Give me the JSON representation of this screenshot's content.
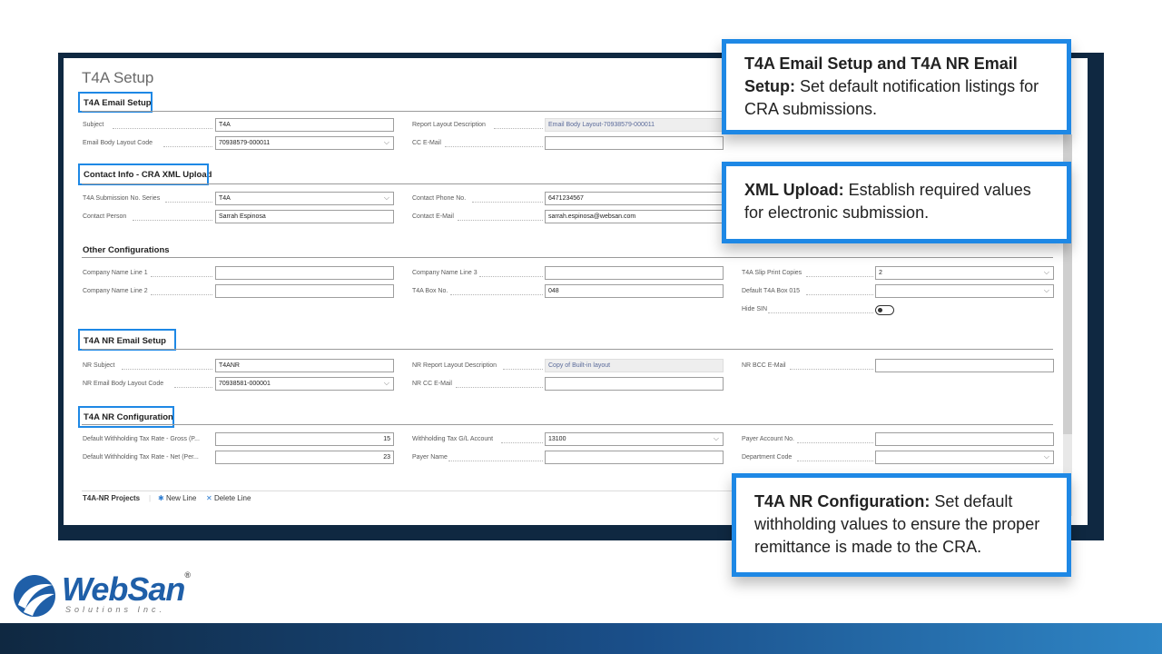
{
  "page_title": "T4A Setup",
  "sections": {
    "email_setup": "T4A Email Setup",
    "contact_info": "Contact Info - CRA XML Upload",
    "other_config": "Other Configurations",
    "nr_email_setup": "T4A NR Email Setup",
    "nr_config": "T4A NR Configuration"
  },
  "email_setup": {
    "subject": {
      "label": "Subject",
      "value": "T4A"
    },
    "body_layout": {
      "label": "Email Body Layout Code",
      "value": "70938579-000011"
    },
    "report_layout": {
      "label": "Report Layout Description",
      "value": "Email Body Layout-70938579-000011"
    },
    "cc_email": {
      "label": "CC E-Mail",
      "value": ""
    }
  },
  "contact_info": {
    "submission_series": {
      "label": "T4A Submission No. Series",
      "value": "T4A"
    },
    "contact_person": {
      "label": "Contact Person",
      "value": "Sarrah Espinosa"
    },
    "phone": {
      "label": "Contact Phone No.",
      "value": "6471234567"
    },
    "email": {
      "label": "Contact E-Mail",
      "value": "sarrah.espinosa@websan.com"
    }
  },
  "other_config": {
    "company_line1": {
      "label": "Company Name Line 1",
      "value": ""
    },
    "company_line2": {
      "label": "Company Name Line 2",
      "value": ""
    },
    "company_line3": {
      "label": "Company Name Line 3",
      "value": ""
    },
    "box_no": {
      "label": "T4A Box No.",
      "value": "048"
    },
    "slip_copies": {
      "label": "T4A Slip Print Copies",
      "value": "2"
    },
    "default_box": {
      "label": "Default T4A Box 015",
      "value": ""
    },
    "hide_sin": {
      "label": "Hide SIN",
      "on": false
    }
  },
  "nr_email_setup": {
    "subject": {
      "label": "NR Subject",
      "value": "T4ANR"
    },
    "body_layout": {
      "label": "NR Email Body Layout Code",
      "value": "70938581-000001"
    },
    "report_layout": {
      "label": "NR Report Layout Description",
      "value": "Copy of Built-in layout"
    },
    "cc_email": {
      "label": "NR CC E-Mail",
      "value": ""
    },
    "bcc_email": {
      "label": "NR BCC E-Mail",
      "value": ""
    }
  },
  "nr_config": {
    "rate_gross": {
      "label": "Default Withholding Tax Rate - Gross (P...",
      "value": "15"
    },
    "rate_net": {
      "label": "Default Withholding Tax Rate - Net (Per...",
      "value": "23"
    },
    "gl_account": {
      "label": "Withholding Tax G/L Account",
      "value": "13100"
    },
    "payer_name": {
      "label": "Payer Name",
      "value": ""
    },
    "payer_account": {
      "label": "Payer Account No.",
      "value": ""
    },
    "department": {
      "label": "Department Code",
      "value": ""
    }
  },
  "projects": {
    "title": "T4A-NR Projects",
    "new_line": "New Line",
    "delete_line": "Delete Line"
  },
  "callouts": {
    "email": {
      "bold": "T4A Email Setup and T4A NR Email Setup:",
      "text": " Set default notification listings for CRA submissions."
    },
    "xml": {
      "bold": "XML Upload:",
      "text": " Establish required values for electronic submission."
    },
    "nr": {
      "bold": "T4A NR Configuration:",
      "text": " Set default withholding values to ensure the proper remittance is made to the CRA."
    }
  },
  "logo": {
    "name": "WebSan",
    "registered": "®",
    "tagline": "Solutions Inc."
  },
  "colors": {
    "highlight": "#1e88e5",
    "frame": "#0f2841",
    "brand_blue": "#1f5fa8"
  }
}
